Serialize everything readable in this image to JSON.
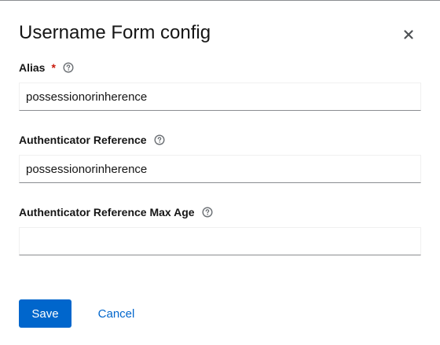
{
  "dialog": {
    "title": "Username Form config"
  },
  "fields": [
    {
      "label": "Alias",
      "required_marker": "*",
      "value": "possessionorinherence"
    },
    {
      "label": "Authenticator Reference",
      "value": "possessionorinherence"
    },
    {
      "label": "Authenticator Reference Max Age",
      "value": ""
    }
  ],
  "actions": {
    "save_label": "Save",
    "cancel_label": "Cancel"
  },
  "icons": {
    "close": "close-icon",
    "help": "help-icon"
  },
  "colors": {
    "primary": "#0066cc",
    "required": "#c9190b",
    "text": "#151515",
    "border_bottom": "#8a8d90",
    "icon": "#6a6e73"
  }
}
